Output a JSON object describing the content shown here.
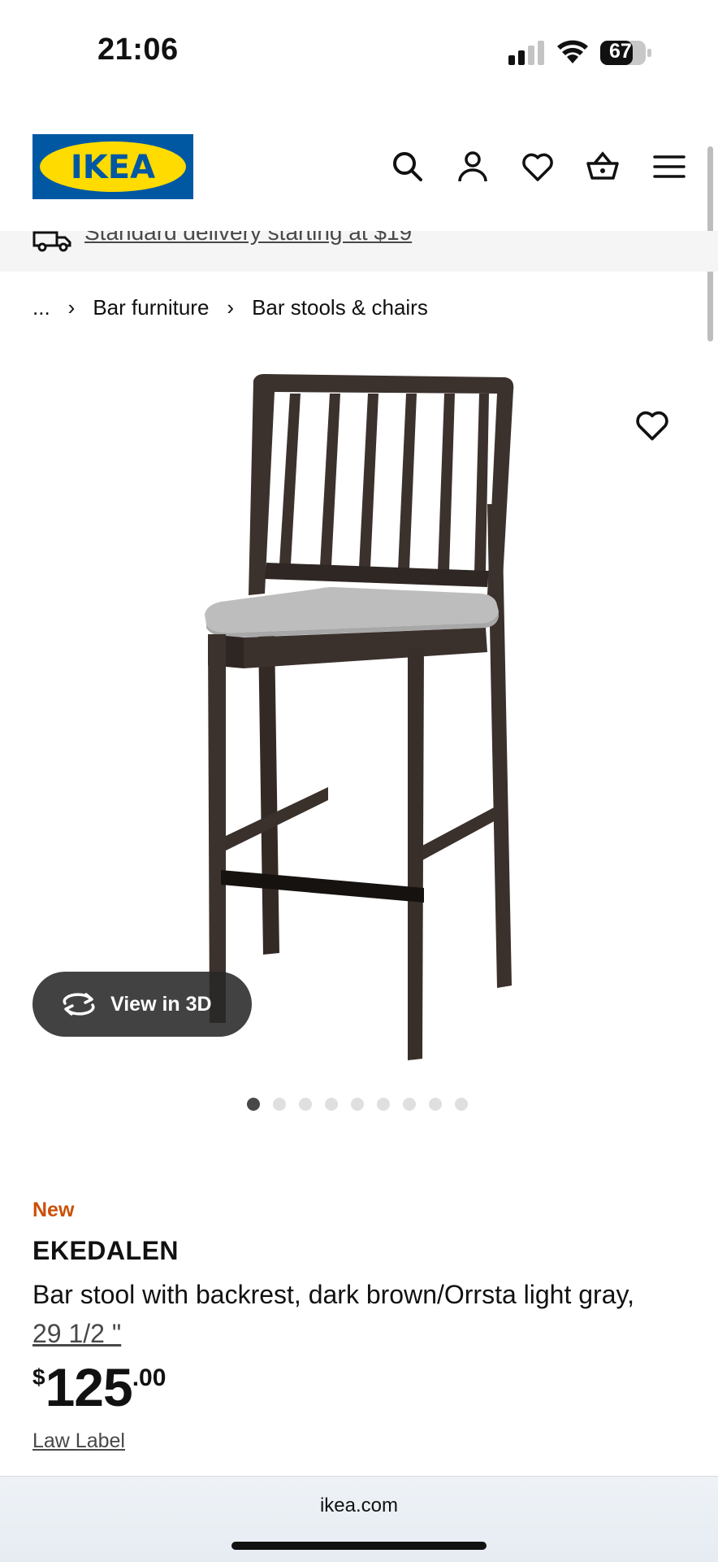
{
  "status_bar": {
    "time": "21:06",
    "battery": "67"
  },
  "header": {
    "logo_text": "IKEA",
    "icons": [
      "search-icon",
      "user-icon",
      "heart-icon",
      "basket-icon",
      "menu-icon"
    ]
  },
  "delivery": {
    "text": "Standard delivery starting at $19"
  },
  "breadcrumb": {
    "ellipsis": "...",
    "items": [
      "Bar furniture",
      "Bar stools & chairs"
    ]
  },
  "gallery": {
    "view3d_label": "View in 3D",
    "image_count": 9,
    "active_index": 0
  },
  "product": {
    "badge": "New",
    "name": "EKEDALEN",
    "description": "Bar stool with backrest, dark brown/Orrsta light gray,",
    "measurement": "29 1/2 \"",
    "price": {
      "currency": "$",
      "integer": "125",
      "decimal": ".00"
    },
    "law_label": "Law Label"
  },
  "browser": {
    "url": "ikea.com"
  },
  "colors": {
    "new_badge": "#ca5008",
    "logo_blue": "#0058a3",
    "logo_yellow": "#ffdb00"
  }
}
